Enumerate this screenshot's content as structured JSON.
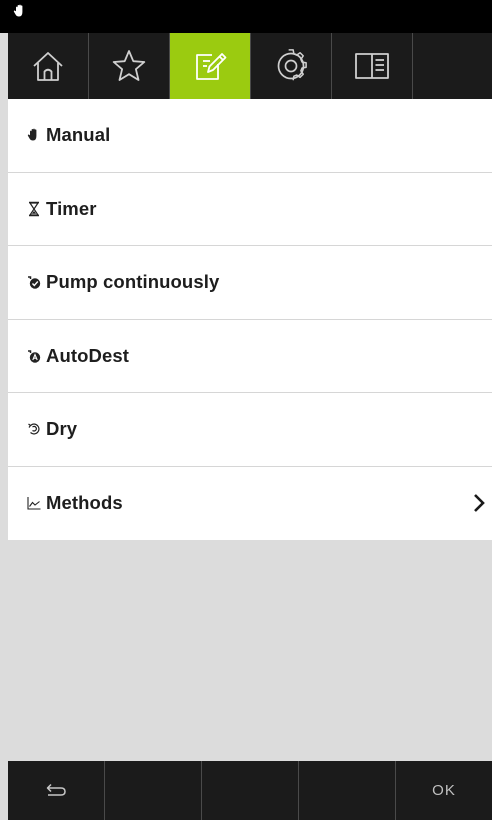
{
  "status_bar": {
    "icon": "hand-icon"
  },
  "tabs": [
    {
      "name": "home",
      "icon": "home-icon",
      "active": false
    },
    {
      "name": "favorites",
      "icon": "star-icon",
      "active": false
    },
    {
      "name": "edit",
      "icon": "edit-icon",
      "active": true
    },
    {
      "name": "settings",
      "icon": "gear-icon",
      "active": false
    },
    {
      "name": "manual",
      "icon": "book-icon",
      "active": false
    }
  ],
  "menu": {
    "items": [
      {
        "label": "Manual",
        "icon": "hand-icon"
      },
      {
        "label": "Timer",
        "icon": "hourglass-icon"
      },
      {
        "label": "Pump continuously",
        "icon": "pump-continuous-icon"
      },
      {
        "label": "AutoDest",
        "icon": "autodest-icon"
      },
      {
        "label": "Dry",
        "icon": "dry-icon"
      },
      {
        "label": "Methods",
        "icon": "chart-line-icon",
        "has_submenu": true
      }
    ]
  },
  "bottom_bar": {
    "back_icon": "return-arrow-icon",
    "ok_label": "OK"
  },
  "colors": {
    "accent": "#9bcb10",
    "bar_background": "#1b1b1b",
    "content_background": "#ffffff",
    "empty_background": "#dcdcdc"
  }
}
